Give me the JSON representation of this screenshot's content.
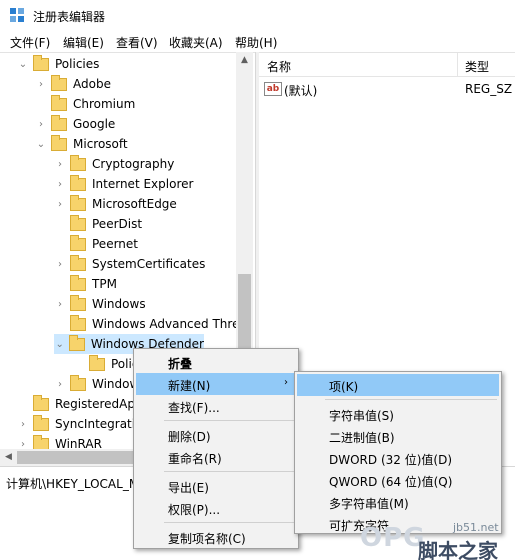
{
  "window": {
    "title": "注册表编辑器"
  },
  "menubar": [
    {
      "label": "文件(F)"
    },
    {
      "label": "编辑(E)"
    },
    {
      "label": "查看(V)"
    },
    {
      "label": "收藏夹(A)"
    },
    {
      "label": "帮助(H)"
    }
  ],
  "tree": [
    {
      "label": "Policies",
      "expander": "v",
      "level": 1
    },
    {
      "label": "Adobe",
      "expander": ">",
      "level": 2
    },
    {
      "label": "Chromium",
      "expander": "",
      "level": 2
    },
    {
      "label": "Google",
      "expander": ">",
      "level": 2
    },
    {
      "label": "Microsoft",
      "expander": "v",
      "level": 2
    },
    {
      "label": "Cryptography",
      "expander": ">",
      "level": 3
    },
    {
      "label": "Internet Explorer",
      "expander": ">",
      "level": 3
    },
    {
      "label": "MicrosoftEdge",
      "expander": ">",
      "level": 3
    },
    {
      "label": "PeerDist",
      "expander": "",
      "level": 3
    },
    {
      "label": "Peernet",
      "expander": "",
      "level": 3
    },
    {
      "label": "SystemCertificates",
      "expander": ">",
      "level": 3
    },
    {
      "label": "TPM",
      "expander": "",
      "level": 3
    },
    {
      "label": "Windows",
      "expander": ">",
      "level": 3
    },
    {
      "label": "Windows Advanced Thre",
      "expander": "",
      "level": 3
    },
    {
      "label": "Windows Defender",
      "expander": "v",
      "level": 3,
      "selected": true
    },
    {
      "label": "Polic",
      "expander": "",
      "level": 4
    },
    {
      "label": "Window",
      "expander": ">",
      "level": 3
    },
    {
      "label": "RegisteredAp",
      "expander": "",
      "level": 1
    },
    {
      "label": "SyncIntegratio",
      "expander": ">",
      "level": 1
    },
    {
      "label": "WinRAR",
      "expander": ">",
      "level": 1
    }
  ],
  "list": {
    "columns": {
      "name": "名称",
      "type": "类型"
    },
    "rows": [
      {
        "icon": "ab",
        "name": "(默认)",
        "type": "REG_SZ"
      }
    ]
  },
  "statusbar": {
    "path": "计算机\\HKEY_LOCAL_M"
  },
  "context_menu": {
    "items": [
      {
        "label": "折叠",
        "bold": true
      },
      {
        "label": "新建(N)",
        "submenu": true,
        "highlight": true
      },
      {
        "label": "查找(F)..."
      },
      {
        "sep": true
      },
      {
        "label": "删除(D)"
      },
      {
        "label": "重命名(R)"
      },
      {
        "sep": true
      },
      {
        "label": "导出(E)"
      },
      {
        "label": "权限(P)..."
      },
      {
        "sep": true
      },
      {
        "label": "复制项名称(C)"
      }
    ]
  },
  "submenu": {
    "items": [
      {
        "label": "项(K)",
        "highlight": true
      },
      {
        "sep": true
      },
      {
        "label": "字符串值(S)"
      },
      {
        "label": "二进制值(B)"
      },
      {
        "label": "DWORD (32 位)值(D)"
      },
      {
        "label": "QWORD (64 位)值(Q)"
      },
      {
        "label": "多字符串值(M)"
      },
      {
        "label": "可扩充字符"
      }
    ]
  },
  "watermark": {
    "logo": "OPG",
    "site": "jb51.net",
    "cn": "脚本之家"
  },
  "colors": {
    "selection": "#cce8ff",
    "menu_highlight": "#91c9f7",
    "folder": "#f7d36b"
  }
}
